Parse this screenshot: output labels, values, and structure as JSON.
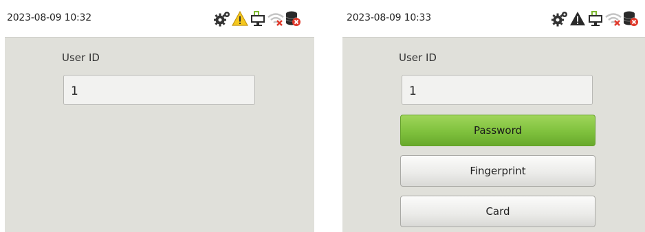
{
  "left_screen": {
    "status_bar": {
      "datetime": "2023-08-09 10:32",
      "icons": [
        "gear-icon",
        "warning-icon",
        "network-icon",
        "wifi-off-icon",
        "database-error-icon"
      ]
    },
    "user_id": {
      "label": "User ID",
      "value": "1"
    }
  },
  "right_screen": {
    "status_bar": {
      "datetime": "2023-08-09 10:33",
      "icons": [
        "gear-icon",
        "warning-icon",
        "network-icon",
        "wifi-off-icon",
        "database-error-icon"
      ]
    },
    "user_id": {
      "label": "User ID",
      "value": "1"
    },
    "verify_options": [
      {
        "label": "Password",
        "selected": true
      },
      {
        "label": "Fingerprint",
        "selected": false
      },
      {
        "label": "Card",
        "selected": false
      }
    ]
  },
  "colors": {
    "screen_bg": "#e0e0da",
    "selected_button": "#7fc13d",
    "warning_fill": "#f5c81e",
    "network_green": "#7cb82f",
    "error_red": "#e0392b"
  }
}
